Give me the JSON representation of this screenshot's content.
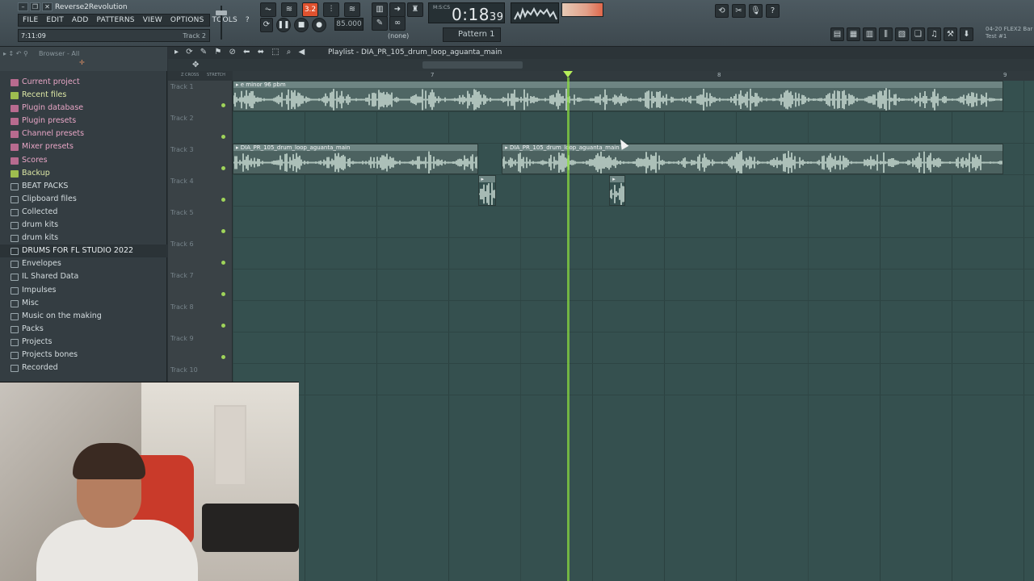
{
  "window": {
    "title": "Reverse2Revolution"
  },
  "menu": [
    "FILE",
    "EDIT",
    "ADD",
    "PATTERNS",
    "VIEW",
    "OPTIONS",
    "TOOLS",
    "?"
  ],
  "hint": {
    "time": "7:11:09",
    "track": "Track 2"
  },
  "transport": {
    "pat_song": "3.2",
    "tempo": "85.000",
    "time": "0:18",
    "time_sub": "39",
    "time_unit": "M:S:CS",
    "pattern": "Pattern 1",
    "none_label": "(none)"
  },
  "news": {
    "line1": "04-20  FLEX2 Bar",
    "line2": "Test #1"
  },
  "browser": {
    "label": "Browser - All",
    "items": [
      {
        "label": "Current project",
        "kind": "pink"
      },
      {
        "label": "Recent files",
        "kind": "gfolder"
      },
      {
        "label": "Plugin database",
        "kind": "pink"
      },
      {
        "label": "Plugin presets",
        "kind": "pink"
      },
      {
        "label": "Channel presets",
        "kind": "pink"
      },
      {
        "label": "Mixer presets",
        "kind": "pink"
      },
      {
        "label": "Scores",
        "kind": "pink"
      },
      {
        "label": "Backup",
        "kind": "gfolder"
      },
      {
        "label": "BEAT PACKS",
        "kind": "folder"
      },
      {
        "label": "Clipboard files",
        "kind": "folder"
      },
      {
        "label": "Collected",
        "kind": "folder"
      },
      {
        "label": "drum kits",
        "kind": "folder"
      },
      {
        "label": "drum kits",
        "kind": "folder"
      },
      {
        "label": "DRUMS FOR FL STUDIO 2022",
        "kind": "folder sel"
      },
      {
        "label": "Envelopes",
        "kind": "folder"
      },
      {
        "label": "IL Shared Data",
        "kind": "folder"
      },
      {
        "label": "Impulses",
        "kind": "folder"
      },
      {
        "label": "Misc",
        "kind": "folder"
      },
      {
        "label": "Music on the making",
        "kind": "folder"
      },
      {
        "label": "Packs",
        "kind": "folder"
      },
      {
        "label": "Projects",
        "kind": "folder"
      },
      {
        "label": "Projects bones",
        "kind": "folder"
      },
      {
        "label": "Recorded",
        "kind": "folder"
      }
    ]
  },
  "playlist": {
    "title": "Playlist - DIA_PR_105_drum_loop_aguanta_main",
    "toggles": [
      "Z CROSS",
      "STRETCH"
    ],
    "bars": [
      "7",
      "8",
      "9"
    ],
    "tracks": [
      "Track 1",
      "Track 2",
      "Track 3",
      "Track 4",
      "Track 5",
      "Track 6",
      "Track 7",
      "Track 8",
      "Track 9",
      "Track 10"
    ],
    "clips": [
      {
        "track": 1,
        "label": "e minor 96 pbm",
        "start": 0.0,
        "end": 0.962,
        "color": "#4f6664"
      },
      {
        "track": 3,
        "label": "DIA_PR_105_drum_loop_aguanta_main",
        "start": 0.0,
        "end": 0.306,
        "color": "#4c6260"
      },
      {
        "track": 3,
        "label": "DIA_PR_105_drum_loop_aguanta_main",
        "start": 0.336,
        "end": 0.962,
        "color": "#4c6260"
      },
      {
        "track": 4,
        "label": "",
        "start": 0.306,
        "end": 0.329,
        "color": "#35504f"
      },
      {
        "track": 4,
        "label": "",
        "start": 0.47,
        "end": 0.49,
        "color": "#35504f"
      }
    ]
  }
}
